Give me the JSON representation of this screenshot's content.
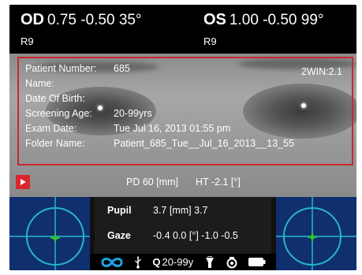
{
  "refraction": {
    "od": {
      "label": "OD",
      "values": "0.75 -0.50 35°",
      "sub": "R9"
    },
    "os": {
      "label": "OS",
      "values": "1.00 -0.50 99°",
      "sub": "R9"
    }
  },
  "patient_info": {
    "patient_number_label": "Patient Number:",
    "patient_number": "685",
    "name_label": "Name:",
    "name": "",
    "dob_label": "Date Of Birth:",
    "dob": "",
    "screening_age_label": "Screening Age:",
    "screening_age": "20-99yrs",
    "exam_date_label": "Exam Date:",
    "exam_date": "Tue Jul 16, 2013 01:55 pm",
    "folder_name_label": "Folder Name:",
    "folder_name": "Patient_685_Tue__Jul_16_2013__13_55",
    "device_tag": "2WIN:2.1"
  },
  "measurements": {
    "pd": "PD 60 [mm]",
    "ht": "HT -2.1 [°]",
    "pupil_label": "Pupil",
    "pupil_value": "3.7 [mm] 3.7",
    "gaze_label": "Gaze",
    "gaze_value": "-0.4  0.0 [°] -1.0  -0.5"
  },
  "status": {
    "q_label": "Q",
    "age_range": "20-99y",
    "icons": [
      "binocular-infinity-icon",
      "usb-icon",
      "flashlight-icon",
      "settings-camera-icon",
      "battery-icon"
    ]
  },
  "colors": {
    "accent_red": "#c8282f",
    "target_blue": "#0f2f6e",
    "crosshair_green": "#2fbf3a",
    "ring_cyan": "#27b7c9",
    "infinity_blue": "#1aa3e8"
  }
}
